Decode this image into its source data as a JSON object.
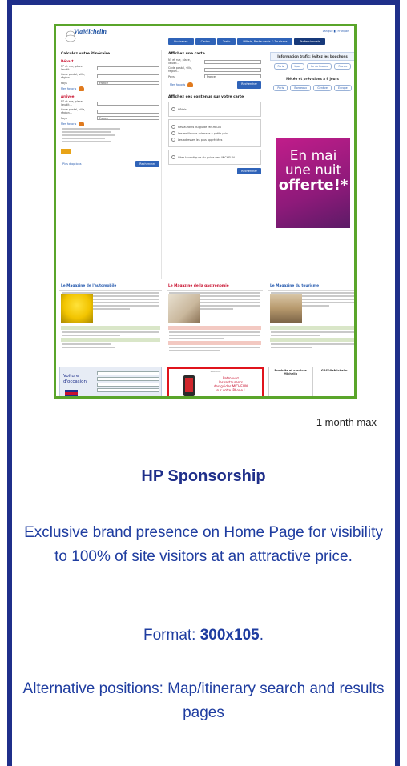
{
  "thumbnail": {
    "logo": "ViaMichelin",
    "nav_tabs": [
      "Itinéraires",
      "Cartes",
      "Trafic",
      "Hôtels, Restaurants & Tourisme",
      "Professionnels"
    ],
    "left_title": "Calculez votre itinéraire",
    "depart": "Départ",
    "arrivee": "Arrivée",
    "field_labels": [
      "N° et rue, place, lieudit...",
      "Code postal, ville, région...",
      "Pays"
    ],
    "country": "France",
    "more_options": "Plus d'options",
    "search_btn": "Rechercher",
    "mid_title": "Affichez une carte",
    "mid_title2": "Affichez ces contenus sur votre carte",
    "mid_options": [
      "Hôtels",
      "Restaurants du guide MICHELIN",
      "Les meilleures adresses à petits prix",
      "Les adresses les plus appréciées",
      "Sites touristiques du guide vert MICHELIN"
    ],
    "right_title": "Information trafic: évitez les bouchons",
    "right_chips": [
      "Paris",
      "Lyon",
      "Ile de France",
      "France"
    ],
    "weather_title": "Météo et prévisions à 9 jours",
    "weather_chips": [
      "Paris",
      "Bordeaux",
      "Genève",
      "Europe"
    ],
    "ad_lines": [
      "En mai",
      "une nuit",
      "offerte!*"
    ],
    "mag_titles": [
      "Le Magazine de l'automobile",
      "Le Magazine de la gastronomie",
      "Le Magazine du tourisme"
    ],
    "voiture": [
      "Voiture",
      "d'occasion"
    ],
    "highlight_pub": "Publicité",
    "highlight_text": [
      "Retrouvez",
      "les restaurants",
      "des guides MICHELIN",
      "sur votre iPhone !"
    ],
    "prod_titles": [
      "Produits et services Michelin",
      "GPS ViaMichelin"
    ]
  },
  "caption": "1 month max",
  "title": "HP Sponsorship",
  "description": "Exclusive brand presence on Home Page for visibility to 100% of site visitors at an attractive price.",
  "format_label": "Format: ",
  "format_value": "300x105",
  "format_end": ".",
  "alternative": "Alternative positions: Map/itinerary search and results pages"
}
